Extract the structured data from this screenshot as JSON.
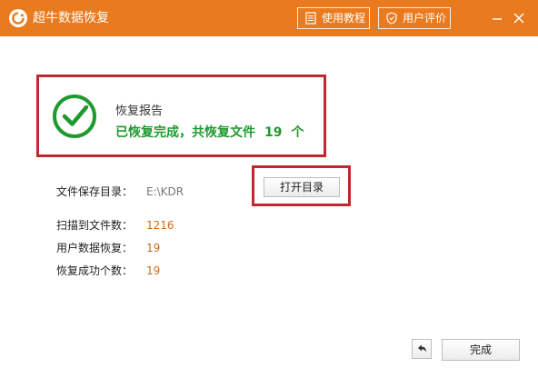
{
  "window": {
    "title": "超牛数据恢复",
    "accent_color": "#ea7a1e",
    "icons": {
      "app": "refresh-app-icon",
      "minimize": "minimize-icon",
      "close": "close-icon"
    }
  },
  "header": {
    "guide_label": "使用教程",
    "guide_icon": "document-icon",
    "rate_label": "用户评价",
    "rate_icon": "shield-icon"
  },
  "report": {
    "title": "恢复报告",
    "result_prefix": "已恢复完成，共恢复文件",
    "result_count": "19",
    "result_suffix": "个",
    "status_icon": "check-circle-icon",
    "status_color": "#1f9a2e",
    "highlight_color": "#c1272d"
  },
  "save_dir": {
    "label": "文件保存目录：",
    "value": "E:\\KDR"
  },
  "open_dir_label": "打开目录",
  "stats": [
    {
      "label": "扫描到文件数：",
      "value": "1216"
    },
    {
      "label": "用户数据恢复：",
      "value": "19"
    },
    {
      "label": "恢复成功个数：",
      "value": "19"
    }
  ],
  "footer": {
    "back_icon": "undo-arrow-icon",
    "done_label": "完成"
  }
}
